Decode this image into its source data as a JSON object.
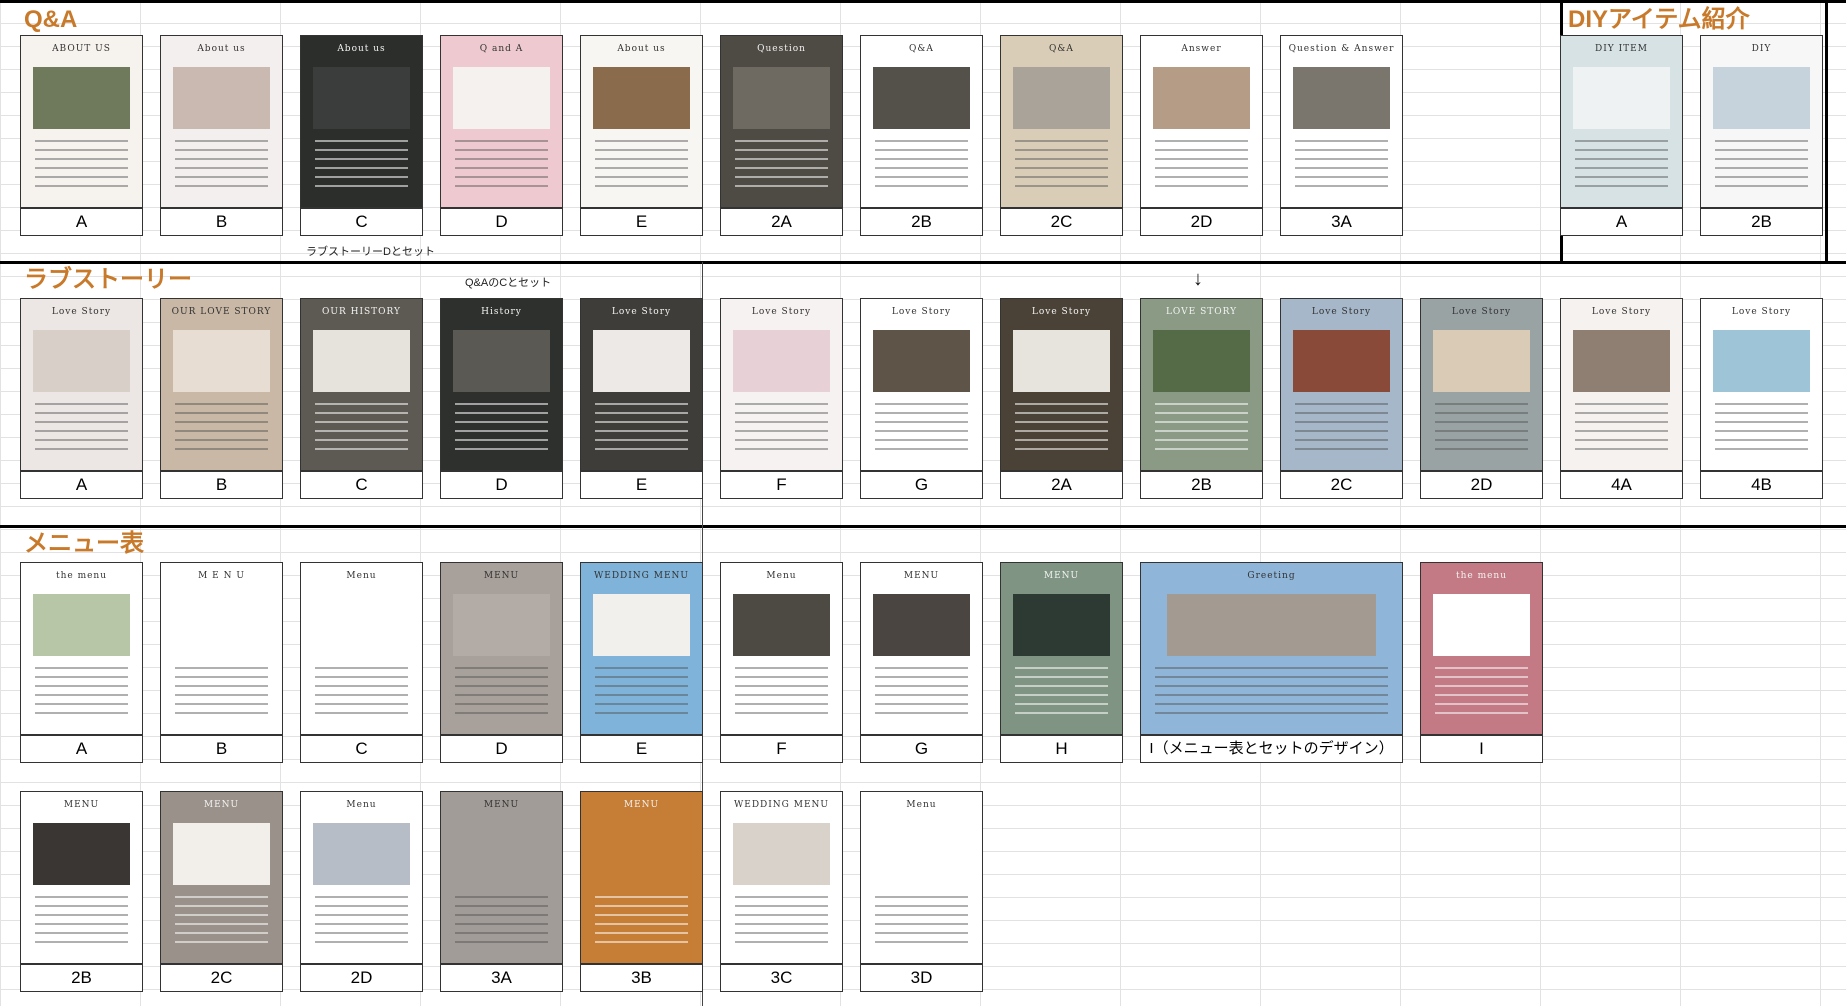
{
  "sections": {
    "qa": "Q&A",
    "diy": "DIYアイテム紹介",
    "love": "ラブストーリー",
    "menu": "メニュー表"
  },
  "notes": {
    "love_d_set": "ラブストーリーDとセット",
    "qa_c_set": "Q&AのCとセット",
    "arrow": "↓"
  },
  "qa": [
    {
      "label": "A",
      "title": "ABOUT US",
      "bg": "#f6f3ee",
      "photo": "#6f7a5c"
    },
    {
      "label": "B",
      "title": "About us",
      "bg": "#f4efef",
      "photo": "#c9b9b0"
    },
    {
      "label": "C",
      "title": "About us",
      "bg": "#2c2e2c",
      "photo": "#3a3d3b"
    },
    {
      "label": "D",
      "title": "Q and A",
      "bg": "#eec9cf",
      "photo": "#f5f1ee"
    },
    {
      "label": "E",
      "title": "About us",
      "bg": "#f8f6f2",
      "photo": "#8a6b4c"
    },
    {
      "label": "2A",
      "title": "Question",
      "bg": "#4e4a44",
      "photo": "#6e6a62"
    },
    {
      "label": "2B",
      "title": "Q&A",
      "bg": "#ffffff",
      "photo": "#54504a"
    },
    {
      "label": "2C",
      "title": "Q&A",
      "bg": "#d9cdb7",
      "photo": "#a9a39a"
    },
    {
      "label": "2D",
      "title": "Answer",
      "bg": "#ffffff",
      "photo": "#b59c86"
    },
    {
      "label": "3A",
      "title": "Question & Answer",
      "bg": "#ffffff",
      "photo": "#7a756d"
    }
  ],
  "diy": [
    {
      "label": "A",
      "title": "DIY ITEM",
      "bg": "#d6e2e4",
      "photo": "#eef2f3"
    },
    {
      "label": "2B",
      "title": "DIY",
      "bg": "#f7f7f7",
      "photo": "#c6d3dd"
    }
  ],
  "love": [
    {
      "label": "A",
      "title": "Love Story",
      "bg": "#ece6e4",
      "photo": "#d8cfc9"
    },
    {
      "label": "B",
      "title": "OUR LOVE STORY",
      "bg": "#c9b8a5",
      "photo": "#e8ddd2"
    },
    {
      "label": "C",
      "title": "OUR HISTORY",
      "bg": "#5c5a52",
      "photo": "#e6e2dc"
    },
    {
      "label": "D",
      "title": "History",
      "bg": "#2e302d",
      "photo": "#5a5954"
    },
    {
      "label": "E",
      "title": "Love Story",
      "bg": "#3f3d3a",
      "photo": "#ece9e6"
    },
    {
      "label": "F",
      "title": "Love Story",
      "bg": "#f7f2f2",
      "photo": "#e7d1d6"
    },
    {
      "label": "G",
      "title": "Love Story",
      "bg": "#ffffff",
      "photo": "#5e5448"
    },
    {
      "label": "2A",
      "title": "Love Story",
      "bg": "#4a4236",
      "photo": "#e7e3dd"
    },
    {
      "label": "2B",
      "title": "LOVE STORY",
      "bg": "#8a9a85",
      "photo": "#556b48"
    },
    {
      "label": "2C",
      "title": "Love Story",
      "bg": "#a5b7c9",
      "photo": "#8a4a3a"
    },
    {
      "label": "2D",
      "title": "Love Story",
      "bg": "#9aa3a4",
      "photo": "#d9cbb6"
    },
    {
      "label": "4A",
      "title": "Love Story",
      "bg": "#f6f2f0",
      "photo": "#8f7f72"
    },
    {
      "label": "4B",
      "title": "Love Story",
      "bg": "#ffffff",
      "photo": "#9ec4d8"
    }
  ],
  "menu1": [
    {
      "label": "A",
      "title": "the menu",
      "bg": "#ffffff",
      "photo": "#b8c6a8"
    },
    {
      "label": "B",
      "title": "M   E   N   U",
      "bg": "#ffffff",
      "photo": "#ffffff"
    },
    {
      "label": "C",
      "title": "Menu",
      "bg": "#ffffff",
      "photo": "#ffffff"
    },
    {
      "label": "D",
      "title": "MENU",
      "bg": "#a8a09a",
      "photo": "#b3aba5"
    },
    {
      "label": "E",
      "title": "WEDDING MENU",
      "bg": "#7fb3d9",
      "photo": "#f2f0ec"
    },
    {
      "label": "F",
      "title": "Menu",
      "bg": "#ffffff",
      "photo": "#4d4a43"
    },
    {
      "label": "G",
      "title": "MENU",
      "bg": "#ffffff",
      "photo": "#4a4540"
    },
    {
      "label": "H",
      "title": "MENU",
      "bg": "#7f9482",
      "photo": "#2d3a33"
    },
    {
      "label": "I（メニュー表とセットのデザイン）",
      "title": "Greeting",
      "bg": "#8fb5d8",
      "photo": "#a39b92",
      "wide": true
    },
    {
      "label": "I",
      "title": "the menu",
      "bg": "#c47a85",
      "photo": "#ffffff"
    }
  ],
  "menu2": [
    {
      "label": "2B",
      "title": "MENU",
      "bg": "#ffffff",
      "photo": "#3a3633"
    },
    {
      "label": "2C",
      "title": "MENU",
      "bg": "#9a928a",
      "photo": "#f2efeb"
    },
    {
      "label": "2D",
      "title": "Menu",
      "bg": "#ffffff",
      "photo": "#b7bdc6"
    },
    {
      "label": "3A",
      "title": "MENU",
      "bg": "#a19c97",
      "photo": "#a19c97"
    },
    {
      "label": "3B",
      "title": "MENU",
      "bg": "#c67d35",
      "photo": "#c67d35"
    },
    {
      "label": "3C",
      "title": "WEDDING MENU",
      "bg": "#ffffff",
      "photo": "#d8d2cb"
    },
    {
      "label": "3D",
      "title": "Menu",
      "bg": "#ffffff",
      "photo": "#ffffff"
    }
  ]
}
